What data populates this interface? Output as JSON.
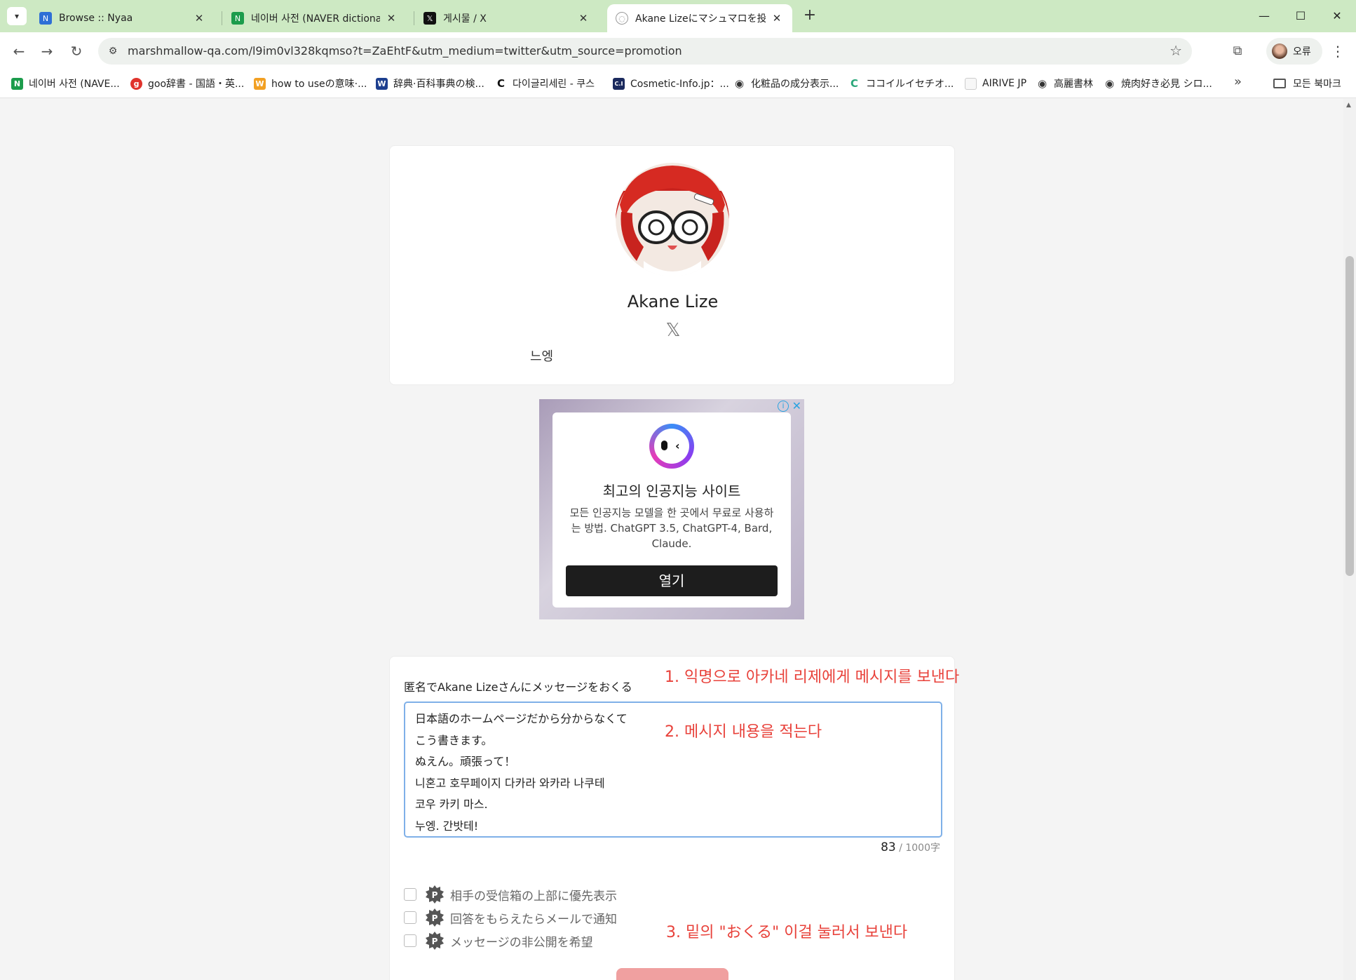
{
  "browser": {
    "tabs": [
      {
        "title": "Browse :: Nyaa",
        "favicon": "nyaa-icon",
        "active": false
      },
      {
        "title": "네이버 사전 (NAVER dictionary",
        "favicon": "naver-icon",
        "active": false
      },
      {
        "title": "게시물 / X",
        "favicon": "x-icon",
        "active": false
      },
      {
        "title": "Akane Lizeにマシュマロを投げ",
        "favicon": "marshmallow-icon",
        "active": true
      }
    ],
    "url": "marshmallow-qa.com/l9im0vl328kqmso?t=ZaEhtF&utm_medium=twitter&utm_source=promotion",
    "profile_label": "오류",
    "bookmarks": [
      {
        "label": "네이버 사전 (NAVE...",
        "icon": "naver-icon"
      },
      {
        "label": "goo辞書 - 国語・英...",
        "icon": "goo-icon"
      },
      {
        "label": "how to useの意味·...",
        "icon": "w-icon"
      },
      {
        "label": "辞典·百科事典の検...",
        "icon": "weblio-icon"
      },
      {
        "label": "다이글리세린 - 쿠스",
        "icon": "c-icon"
      },
      {
        "label": "Cosmetic-Info.jp：...",
        "icon": "ci-icon"
      },
      {
        "label": "化粧品の成分表示...",
        "icon": "globe-icon"
      },
      {
        "label": "ココイルイセチオ...",
        "icon": "c-green-icon"
      },
      {
        "label": "AIRIVE JP",
        "icon": "page-icon"
      },
      {
        "label": "高麗書林",
        "icon": "globe-icon"
      },
      {
        "label": "焼肉好き必見 シロ...",
        "icon": "globe-icon"
      }
    ],
    "all_bookmarks_label": "모든 북마크"
  },
  "profile": {
    "name": "Akane Lize",
    "bio": "느엥"
  },
  "ad": {
    "title": "최고의 인공지능 사이트",
    "description": "모든 인공지능 모델을 한 곳에서 무료로 사용하는 방법. ChatGPT 3.5, ChatGPT-4, Bard, Claude.",
    "cta": "열기"
  },
  "form": {
    "label": "匿名でAkane Lizeさんにメッセージをおくる",
    "message": "日本語のホームページだから分からなくて\nこう書きます。\nぬえん。頑張って！\n니혼고 호무페이지 다카라 와카라 나쿠테\n코우 카키 마스.\n누엥. 간밧테!",
    "char_count": "83",
    "char_limit": "/ 1000字",
    "options": [
      {
        "label": "相手の受信箱の上部に優先表示",
        "checked": false
      },
      {
        "label": "回答をもらえたらメールで通知",
        "checked": false
      },
      {
        "label": "メッセージの非公開を希望",
        "checked": false
      }
    ]
  },
  "annotations": {
    "note1": "1. 익명으로 아카네 리제에게 메시지를 보낸다",
    "note2": "2. 메시지 내용을 적는다",
    "note3": "3. 밑의 \"おくる\" 이걸 눌러서 보낸다"
  },
  "colors": {
    "annotation_red": "#e8413a",
    "tabstrip_green": "#cde9c3",
    "submit_pink": "#f0a0a0",
    "textarea_focus_blue": "#7fb0e8"
  }
}
